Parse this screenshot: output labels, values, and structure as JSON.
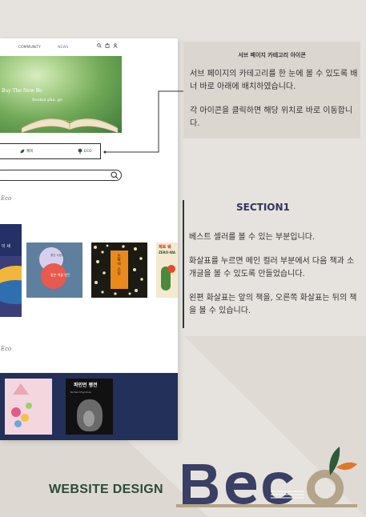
{
  "site": {
    "nav": {
      "community": "COMMUNITY",
      "news": "NEWS"
    },
    "hero": {
      "headline": "Buy The New Bo",
      "subline": "Bookin pha..go"
    },
    "menu": {
      "item_a": "제목",
      "item_b": "ECO"
    },
    "brand_small": "Eco",
    "books": {
      "main_title": "이 세",
      "book2_top": "좋은 사람이",
      "book2_bottom": "좋은 책을 만든",
      "book3_spine": "초록색 소설",
      "book4_title": "제로 웨",
      "book4_sub": "ZERO-WA",
      "book6_title": "파인먼 평전",
      "book6_sub": "Richard Feynman"
    }
  },
  "note": {
    "title": "서브 페이지 카테고리 아이콘",
    "para1": "서브 페이지의 카테고리를 한 눈에 볼 수 있도록 배너 바로 아래에 배치하였습니다.",
    "para2": "각 아이콘을 클릭하면 해당 위치로 바로 이동합니다."
  },
  "section1": {
    "title": "SECTION1",
    "para1": "베스트 셀러를 볼 수 있는 부분입니다.",
    "para2": "화살표를 누르면 메인 컬러 부분에서 다음 책과 소개글을 볼 수 있도록 만들었습니다.",
    "para3": "왼편 화살표는 앞의 책을, 오른쪽 화살표는 뒤의 책을 볼 수 있습니다."
  },
  "footer": {
    "label": "WEBSITE DESIGN",
    "logo_text": "Beco"
  },
  "colors": {
    "background": "#e6e2dd",
    "card": "#dcd6d0",
    "navy": "#23305a",
    "brand_green": "#2c4a3a",
    "logo_navy": "#3a3f66",
    "logo_beige": "#b4a48a"
  }
}
